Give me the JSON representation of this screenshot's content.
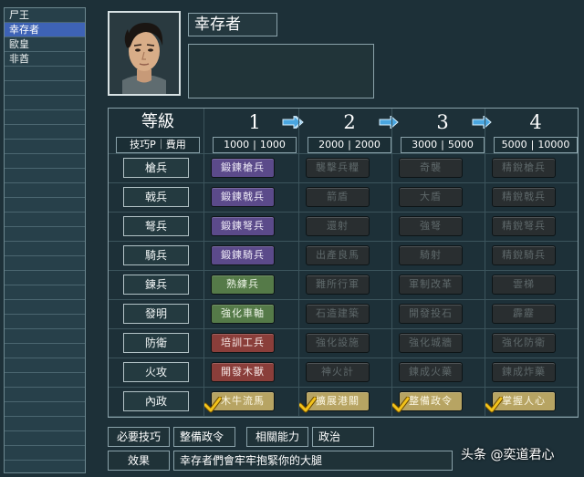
{
  "list": {
    "items": [
      "尸王",
      "幸存者",
      "歐皇",
      "非酋"
    ],
    "selected_index": 1,
    "empty_rows": 27
  },
  "hero": {
    "name": "幸存者",
    "portrait_icon": "portrait-icon"
  },
  "grid": {
    "level_header": "等級",
    "resource_header": "技巧P｜費用",
    "levels": [
      {
        "label": "1",
        "skill_points": "1000",
        "cost": "1000"
      },
      {
        "label": "2",
        "skill_points": "2000",
        "cost": "2000"
      },
      {
        "label": "3",
        "skill_points": "3000",
        "cost": "5000"
      },
      {
        "label": "4",
        "skill_points": "5000",
        "cost": "10000"
      }
    ],
    "rows": [
      {
        "category": "槍兵",
        "skills": [
          {
            "label": "鍛鍊槍兵",
            "state": "purple"
          },
          {
            "label": "襲擊兵糧",
            "state": "locked"
          },
          {
            "label": "奇襲",
            "state": "locked"
          },
          {
            "label": "精銳槍兵",
            "state": "locked"
          }
        ]
      },
      {
        "category": "戟兵",
        "skills": [
          {
            "label": "鍛鍊戟兵",
            "state": "purple"
          },
          {
            "label": "箭盾",
            "state": "locked"
          },
          {
            "label": "大盾",
            "state": "locked"
          },
          {
            "label": "精銳戟兵",
            "state": "locked"
          }
        ]
      },
      {
        "category": "弩兵",
        "skills": [
          {
            "label": "鍛鍊弩兵",
            "state": "purple"
          },
          {
            "label": "還射",
            "state": "locked"
          },
          {
            "label": "強弩",
            "state": "locked"
          },
          {
            "label": "精銳弩兵",
            "state": "locked"
          }
        ]
      },
      {
        "category": "騎兵",
        "skills": [
          {
            "label": "鍛鍊騎兵",
            "state": "purple"
          },
          {
            "label": "出產良馬",
            "state": "locked"
          },
          {
            "label": "騎射",
            "state": "locked"
          },
          {
            "label": "精銳騎兵",
            "state": "locked"
          }
        ]
      },
      {
        "category": "鍊兵",
        "skills": [
          {
            "label": "熟練兵",
            "state": "green"
          },
          {
            "label": "難所行軍",
            "state": "locked"
          },
          {
            "label": "軍制改革",
            "state": "locked"
          },
          {
            "label": "雲梯",
            "state": "locked"
          }
        ]
      },
      {
        "category": "發明",
        "skills": [
          {
            "label": "強化車軸",
            "state": "green"
          },
          {
            "label": "石造建築",
            "state": "locked"
          },
          {
            "label": "開發投石",
            "state": "locked"
          },
          {
            "label": "霹靂",
            "state": "locked"
          }
        ]
      },
      {
        "category": "防衛",
        "skills": [
          {
            "label": "培訓工兵",
            "state": "red"
          },
          {
            "label": "強化設施",
            "state": "locked"
          },
          {
            "label": "強化城牆",
            "state": "locked"
          },
          {
            "label": "強化防衛",
            "state": "locked"
          }
        ]
      },
      {
        "category": "火攻",
        "skills": [
          {
            "label": "開發木獸",
            "state": "red"
          },
          {
            "label": "神火計",
            "state": "locked"
          },
          {
            "label": "鍊成火藥",
            "state": "locked"
          },
          {
            "label": "鍊成炸藥",
            "state": "locked"
          }
        ]
      },
      {
        "category": "內政",
        "skills": [
          {
            "label": "木牛流馬",
            "state": "gold",
            "checked": true
          },
          {
            "label": "擴展港關",
            "state": "gold",
            "checked": true
          },
          {
            "label": "整備政令",
            "state": "gold",
            "checked": true
          },
          {
            "label": "掌握人心",
            "state": "gold",
            "checked": true
          }
        ]
      }
    ]
  },
  "bottom": {
    "required_label": "必要技巧",
    "required_value": "整備政令",
    "related_label": "相關能力",
    "related_value": "政治",
    "effect_label": "效果",
    "effect_value": "幸存者們會牢牢抱緊你的大腿"
  },
  "watermark": "头条 @奕道君心",
  "colors": {
    "background": "#1d3038",
    "selection": "#3e63b6",
    "arrow": "#4aa6e0",
    "check": "#f2c21a"
  }
}
